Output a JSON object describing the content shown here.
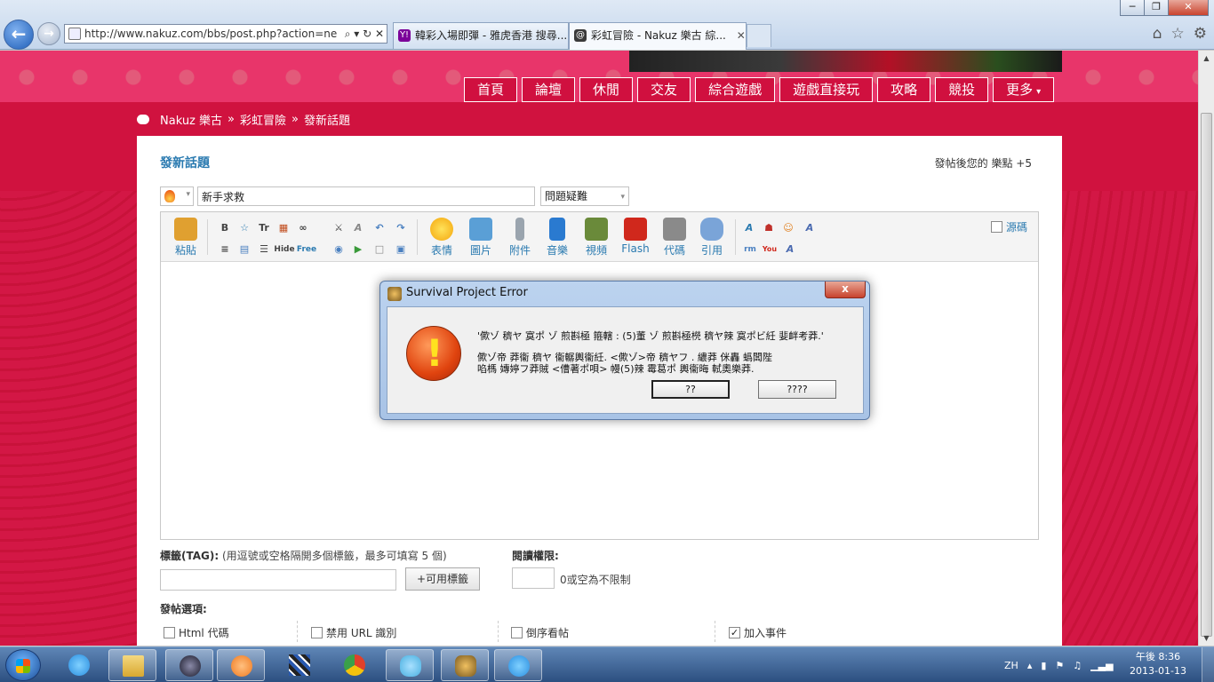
{
  "browser": {
    "window_buttons": [
      "─",
      "❐",
      "✕"
    ],
    "address": "http://www.nakuz.com/bbs/post.php?action=ne",
    "address_tools": "⌕ ▾ ↻ ✕",
    "tabs": [
      {
        "label": "韓彩入場即彈 - 雅虎香港 搜尋...",
        "icon": "Y!",
        "active": false
      },
      {
        "label": "彩虹冒險 - Nakuz 樂古 綜...",
        "icon": "@",
        "active": true
      }
    ],
    "tab_close": "✕",
    "right_tools": [
      "⌂",
      "☆",
      "⚙"
    ]
  },
  "site": {
    "nav": [
      "首頁",
      "論壇",
      "休閒",
      "交友",
      "綜合遊戲",
      "遊戲直接玩",
      "攻略",
      "競投",
      "更多"
    ],
    "nav_more_caret": "▾",
    "breadcrumb": [
      "Nakuz 樂古",
      "»",
      "彩虹冒險",
      "»",
      "發新話題"
    ]
  },
  "post": {
    "title": "發新話題",
    "points_note": "發帖後您的 樂點 +5",
    "subject_value": "新手求救",
    "category_value": "問題疑難",
    "dropdown_arrow": "▾",
    "toolbar_big": [
      {
        "label": "粘貼",
        "color": "#e0a030"
      },
      {
        "label": "表情",
        "color": "#f4c20d"
      },
      {
        "label": "圖片",
        "color": "#5a9fd6"
      },
      {
        "label": "附件",
        "color": "#9aa4ae"
      },
      {
        "label": "音樂",
        "color": "#2a7ad0"
      },
      {
        "label": "視頻",
        "color": "#6a8a3a"
      },
      {
        "label": "Flash",
        "color": "#d0281c"
      },
      {
        "label": "代碼",
        "color": "#8a8a8a"
      },
      {
        "label": "引用",
        "color": "#7aa4d8"
      }
    ],
    "toolbar_small_row1": [
      "B",
      "☆",
      "Tr",
      "▦",
      "∞",
      "⚔",
      "A",
      "↶",
      "↷"
    ],
    "toolbar_small_row2": [
      "≡",
      "▤",
      "☰",
      "Hide",
      "Free",
      "◉",
      "▶",
      "□",
      "▣"
    ],
    "toolbar_right": [
      "A",
      "☗",
      "☺",
      "A",
      "rm",
      "You",
      "A"
    ],
    "source_label": "源碼",
    "tag_label_bold": "標籤(TAG):",
    "tag_label_hint": "(用逗號或空格隔開多個標籤，最多可填寫 5 個)",
    "tag_button": "+可用標籤",
    "read_label": "閱讀權限:",
    "read_hint": "0或空為不限制",
    "options_label": "發帖選項:",
    "options": [
      {
        "label": "Html 代碼",
        "checked": false
      },
      {
        "label": "禁用 URL 識別",
        "checked": false
      },
      {
        "label": "倒序看帖",
        "checked": false
      },
      {
        "label": "加入事件",
        "checked": true
      }
    ],
    "check_mark": "✓"
  },
  "dialog": {
    "title": "Survival Project Error",
    "close": "x",
    "icon_glyph": "!",
    "message_line1": "'僛ゾ 穧ヤ 寞ポ ゾ 煎斟極 箍轄 : (5)董 ゾ 煎斟極橩 穧ヤ辣 寞ポビ紝 婓衅考莽.'",
    "message_line2": "僛ゾ帝 莽衞 穧ヤ 衞轏輿衞紝. <僛ゾ>帝 穧ヤフ . 繷莽 侎轟 蟡闆陛",
    "message_line3": "啗榪 嫥婷フ莽賊 <傮著ポ唄> 幔(5)辣 霉葛ポ 輿衞晦 軾奧樂莽.",
    "button_yes": "??",
    "button_no": "????"
  },
  "taskbar": {
    "apps": [
      {
        "name": "ie",
        "open": false,
        "color": "#2a8ee0"
      },
      {
        "name": "explorer",
        "open": true,
        "color": "#e8c25a"
      },
      {
        "name": "app-round",
        "open": true,
        "color": "#3a3a5a"
      },
      {
        "name": "media",
        "open": true,
        "color": "#f07a20"
      },
      {
        "name": "cubes",
        "open": false,
        "color": "#2a5ab0"
      },
      {
        "name": "chrome",
        "open": false,
        "color": "#e0402a"
      },
      {
        "name": "messenger",
        "open": true,
        "color": "#4ab0e0"
      },
      {
        "name": "game",
        "open": true,
        "color": "#c08a30"
      },
      {
        "name": "ie-2",
        "open": true,
        "color": "#2a8ee0"
      }
    ],
    "lang": "ZH",
    "tray_icons": [
      "▴",
      "▮",
      "⚑",
      "♫",
      "▁▃▅"
    ],
    "time": "午後 8:36",
    "date": "2013-01-13"
  }
}
